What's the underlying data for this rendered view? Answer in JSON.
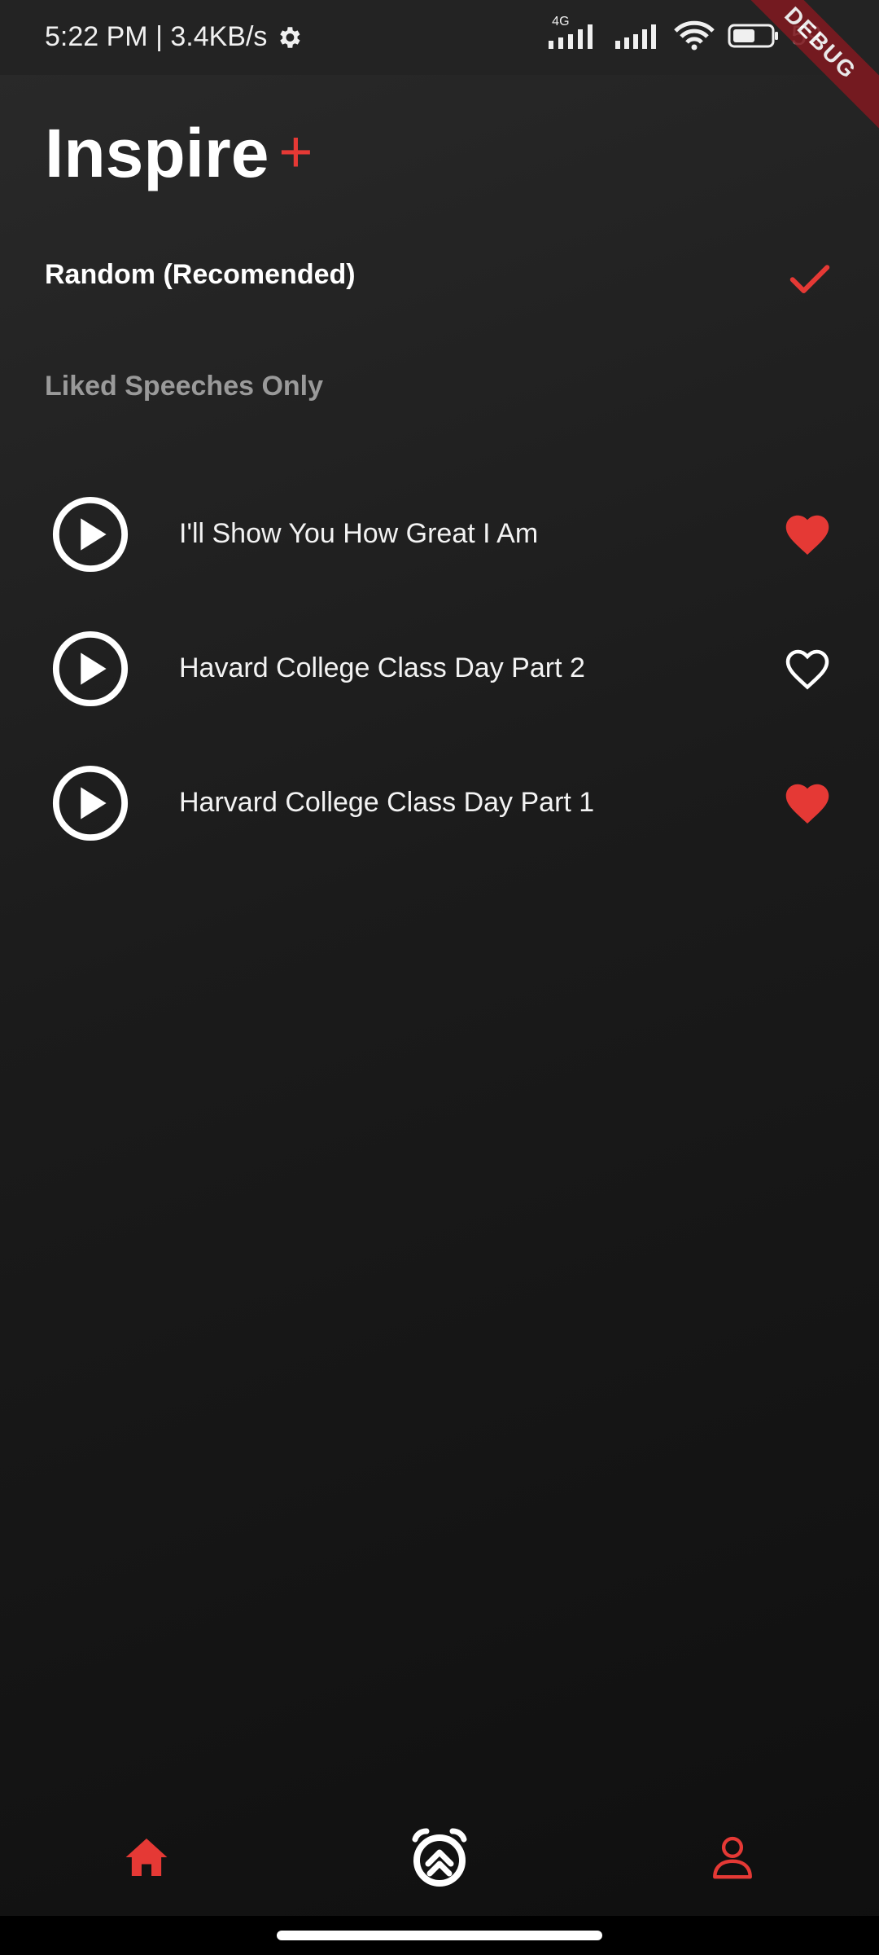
{
  "status_bar": {
    "time_speed": "5:22 PM | 3.4KB/s",
    "network": "4G",
    "battery": "59",
    "debug_label": "DEBUG"
  },
  "app": {
    "title": "Inspire",
    "title_plus": "+"
  },
  "filters": {
    "random_label": "Random (Recomended)",
    "liked_label": "Liked Speeches Only",
    "random_selected": true
  },
  "speeches": [
    {
      "title": "I'll Show You How Great I Am",
      "liked": true
    },
    {
      "title": "Havard College Class Day Part 2",
      "liked": false
    },
    {
      "title": "Harvard College Class Day Part 1",
      "liked": true
    }
  ],
  "bottom_nav": {
    "items": [
      {
        "icon": "home-icon",
        "active": true
      },
      {
        "icon": "alarm-icon",
        "active": false
      },
      {
        "icon": "profile-icon",
        "active": false
      }
    ]
  },
  "colors": {
    "accent": "#e53935",
    "text": "#ffffff",
    "muted": "#9a9a9a",
    "background": "#1b1b1b"
  }
}
